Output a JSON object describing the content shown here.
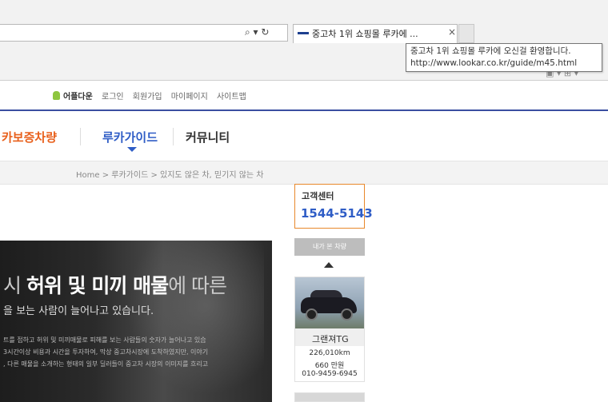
{
  "browser": {
    "address_icons": "⌕ ▾ ↻",
    "tab_title": "중고차 1위 쇼핑몰 루카에 ...",
    "tab_close": "×",
    "tooltip_line1": "중고차 1위 쇼핑몰 루카에 오신걸 환영합니다.",
    "tooltip_line2": "http://www.lookar.co.kr/guide/m45.html",
    "toolbar_icons": "▣ ▾  ⊞ ▾"
  },
  "site": {
    "topnav": {
      "app_download": "어플다운",
      "login": "로그인",
      "join": "회원가입",
      "mypage": "마이페이지",
      "sitemap": "사이트맵"
    },
    "gnb": {
      "item1": "카보증차량",
      "item2": "루카가이드",
      "item3": "커뮤니티"
    },
    "breadcrumb": "Home > 루카가이드 > 있지도 않은 차, 믿기지 않는 차",
    "colors": {
      "accent_blue": "#2f5dc6",
      "accent_orange": "#e8601c"
    }
  },
  "hero": {
    "head_prefix": "시 ",
    "head_main": "허위 및 미끼 매물",
    "head_suffix": "에 따른",
    "sub": "을 보는 사람이 늘어나고 있습니다.",
    "body1": "트를 접하고 허위 및 미끼매물로 피해를 보는 사람들의 숫자가 늘어나고 있습",
    "body2": "3시간이상 비용과 시간을 투자하여, 막상 중고차시장에 도착하였지만, 이야기",
    "body3": ", 다른 매물을 소개하는 형태의 일부 딜러들이 중고차 시장의 이미지를 흐리고"
  },
  "sidebar": {
    "cs_label": "고객센터",
    "cs_phone": "1544-5143",
    "recent_label": "내가 본 차량",
    "card": {
      "name": "그랜져TG",
      "mileage": "226,010km",
      "price": "660 만원",
      "phone": "010-9459-6945"
    }
  }
}
